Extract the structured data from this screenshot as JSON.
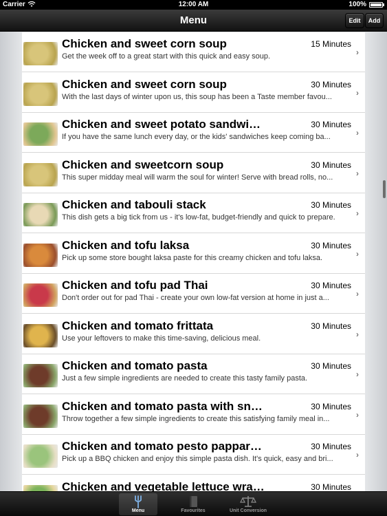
{
  "status_bar": {
    "carrier": "Carrier",
    "time": "12:00 AM",
    "battery": "100%"
  },
  "nav": {
    "title": "Menu",
    "edit_label": "Edit",
    "add_label": "Add"
  },
  "recipes": [
    {
      "title": "Chicken and sweet corn soup",
      "time": "15 Minutes",
      "desc": "Get the week off to a great start with this quick and easy soup.",
      "thumb": "soup"
    },
    {
      "title": "Chicken and sweet corn soup",
      "time": "30 Minutes",
      "desc": "With the last days of winter upon us, this soup has been a Taste member favou...",
      "thumb": "soup"
    },
    {
      "title": "Chicken and sweet potato sandwi…",
      "time": "30 Minutes",
      "desc": "If you have the same lunch every day, or the kids' sandwiches keep coming ba...",
      "thumb": "sandwich"
    },
    {
      "title": "Chicken and sweetcorn soup",
      "time": "30 Minutes",
      "desc": "This super midday meal will warm the soul for winter! Serve with bread rolls, no...",
      "thumb": "soup"
    },
    {
      "title": "Chicken and tabouli stack",
      "time": "30 Minutes",
      "desc": "This dish gets a big tick from us - it's low-fat, budget-friendly and quick to prepare.",
      "thumb": "stack"
    },
    {
      "title": "Chicken and tofu laksa",
      "time": "30 Minutes",
      "desc": "Pick up some store bought laksa paste for this creamy chicken and tofu laksa.",
      "thumb": "laksa"
    },
    {
      "title": "Chicken and tofu pad Thai",
      "time": "30 Minutes",
      "desc": "Don't order out for pad Thai - create your own low-fat version at home in just a...",
      "thumb": "padthai"
    },
    {
      "title": "Chicken and tomato frittata",
      "time": "30 Minutes",
      "desc": "Use your leftovers to make this time-saving, delicious meal.",
      "thumb": "frittata"
    },
    {
      "title": "Chicken and tomato pasta",
      "time": "30 Minutes",
      "desc": "Just a few simple ingredients are needed to create this tasty family pasta.",
      "thumb": "pasta"
    },
    {
      "title": "Chicken and tomato pasta with sn…",
      "time": "30 Minutes",
      "desc": "Throw together a few simple ingredients to create this satisfying family meal in...",
      "thumb": "pasta"
    },
    {
      "title": "Chicken and tomato pesto pappar…",
      "time": "30 Minutes",
      "desc": "Pick up a BBQ chicken and enjoy this simple pasta dish. It's quick, easy and bri...",
      "thumb": "pesto"
    },
    {
      "title": "Chicken and vegetable lettuce wra…",
      "time": "30 Minutes",
      "desc": "",
      "thumb": "wrap"
    }
  ],
  "thumb_colors": {
    "soup": [
      "#d8c57a",
      "#b9a44f"
    ],
    "sandwich": [
      "#7ca95a",
      "#e0c58f"
    ],
    "stack": [
      "#e8d9b5",
      "#7a9a57"
    ],
    "laksa": [
      "#d98a3c",
      "#9b4f2c"
    ],
    "padthai": [
      "#c9394a",
      "#d1a15e"
    ],
    "frittata": [
      "#e0b44d",
      "#6b4f2a"
    ],
    "pasta": [
      "#6e3b2a",
      "#8aa56a"
    ],
    "pesto": [
      "#9ac47c",
      "#e7dfc6"
    ],
    "wrap": [
      "#7bb35a",
      "#e4d59b"
    ]
  },
  "tabs": [
    {
      "label": "Menu",
      "icon": "fork-icon"
    },
    {
      "label": "Favourites",
      "icon": "book-icon"
    },
    {
      "label": "Unit Conversion",
      "icon": "scale-icon"
    }
  ],
  "chevron": "›"
}
